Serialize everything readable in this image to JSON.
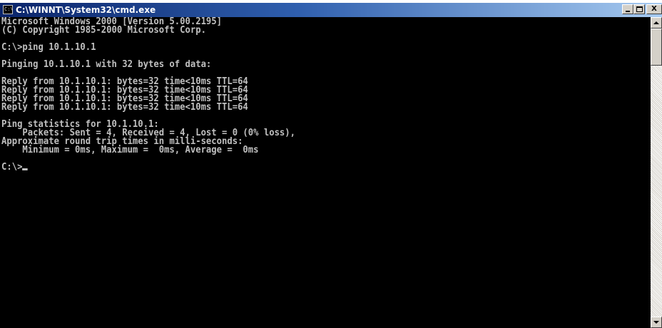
{
  "window": {
    "title": "C:\\WINNT\\System32\\cmd.exe",
    "icon": "console-app-icon",
    "icon_glyph": "C:\\",
    "buttons": {
      "minimize_icon": "minimize-icon",
      "maximize_icon": "maximize-icon",
      "close_icon": "close-icon",
      "close_glyph": "X"
    }
  },
  "console": {
    "colors": {
      "background": "#000000",
      "text": "#c0c0c0"
    },
    "lines": [
      "Microsoft Windows 2000 [Version 5.00.2195]",
      "(C) Copyright 1985-2000 Microsoft Corp.",
      "",
      "C:\\>ping 10.1.10.1",
      "",
      "Pinging 10.1.10.1 with 32 bytes of data:",
      "",
      "Reply from 10.1.10.1: bytes=32 time<10ms TTL=64",
      "Reply from 10.1.10.1: bytes=32 time<10ms TTL=64",
      "Reply from 10.1.10.1: bytes=32 time<10ms TTL=64",
      "Reply from 10.1.10.1: bytes=32 time<10ms TTL=64",
      "",
      "Ping statistics for 10.1.10.1:",
      "    Packets: Sent = 4, Received = 4, Lost = 0 (0% loss),",
      "Approximate round trip times in milli-seconds:",
      "    Minimum = 0ms, Maximum =  0ms, Average =  0ms",
      ""
    ],
    "prompt": "C:\\>"
  },
  "scrollbar": {
    "up_icon": "scroll-up-arrow-icon",
    "down_icon": "scroll-down-arrow-icon"
  }
}
